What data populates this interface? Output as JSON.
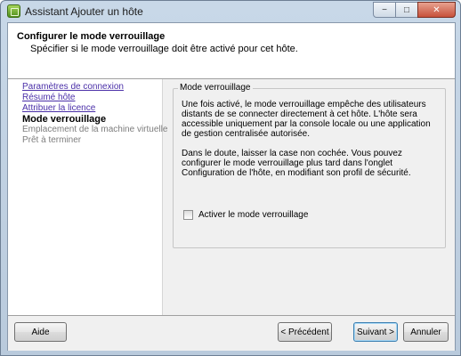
{
  "window": {
    "title": "Assistant Ajouter un hôte",
    "buttons": {
      "minimize": "−",
      "maximize": "□",
      "close": "✕"
    }
  },
  "header": {
    "title": "Configurer le mode verrouillage",
    "subtitle": "Spécifier si le mode verrouillage doit être activé pour cet hôte."
  },
  "nav": {
    "items": [
      {
        "label": "Paramètres de connexion",
        "state": "link"
      },
      {
        "label": "Résumé hôte",
        "state": "link"
      },
      {
        "label": "Attribuer la licence",
        "state": "link"
      },
      {
        "label": "Mode verrouillage",
        "state": "current"
      },
      {
        "label": "Emplacement de la machine virtuelle",
        "state": "disabled"
      },
      {
        "label": "Prêt à terminer",
        "state": "disabled"
      }
    ]
  },
  "group": {
    "legend": "Mode verrouillage",
    "paragraph1": "Une fois activé, le mode verrouillage empêche des utilisateurs distants de se connecter directement à cet hôte. L'hôte sera accessible uniquement par la console locale ou une application de gestion centralisée autorisée.",
    "paragraph2": "Dans le doute, laisser la case non cochée. Vous pouvez configurer le mode verrouillage plus tard dans l'onglet Configuration de l'hôte, en modifiant son profil de sécurité.",
    "checkbox_label": "Activer le mode verrouillage",
    "checkbox_checked": false
  },
  "footer": {
    "help": "Aide",
    "previous": "< Précédent",
    "next": "Suivant >",
    "cancel": "Annuler"
  }
}
